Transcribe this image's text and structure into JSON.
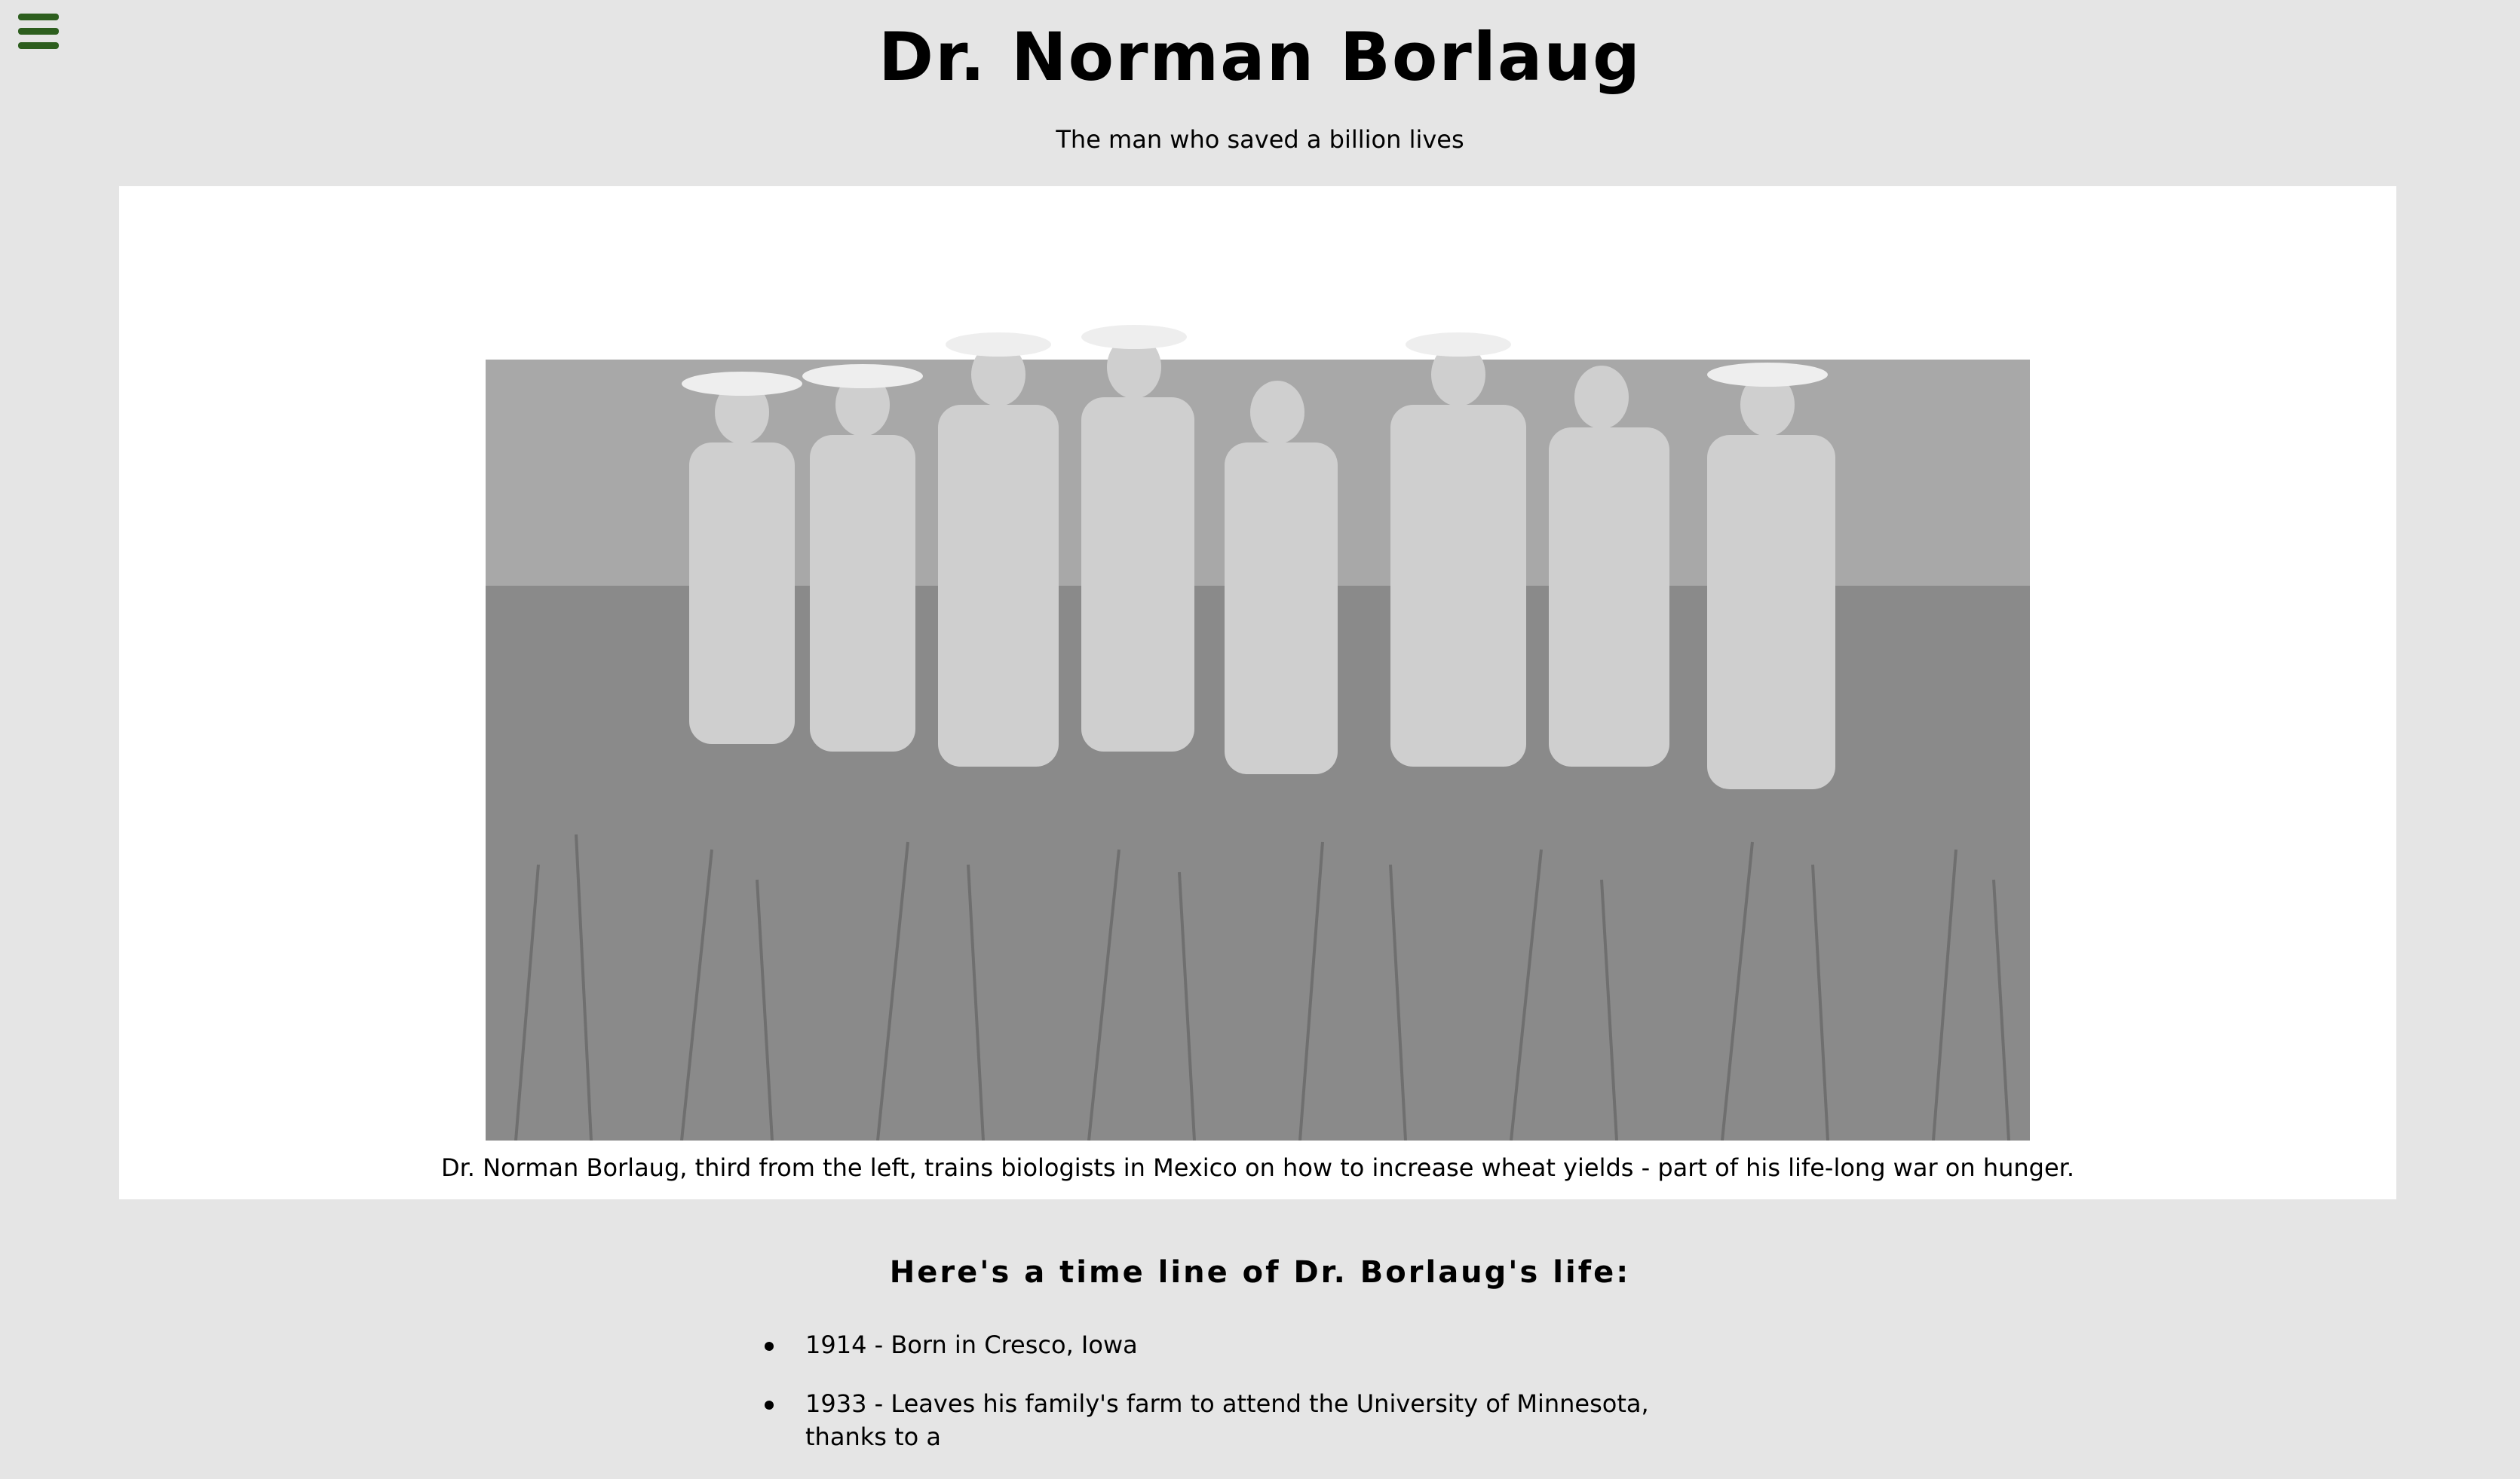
{
  "nav": {
    "menu_icon": "hamburger-menu-icon",
    "menu_color": "#2d5e1e"
  },
  "header": {
    "title": "Dr. Norman Borlaug",
    "subtitle": "The man who saved a billion lives"
  },
  "photo": {
    "caption": "Dr. Norman Borlaug, third from the left, trains biologists in Mexico on how to increase wheat yields - part of his life-long war on hunger."
  },
  "timeline": {
    "heading": "Here's a time line of Dr. Borlaug's life:",
    "items": [
      "1914 - Born in Cresco, Iowa",
      "1933 - Leaves his family's farm to attend the University of Minnesota, thanks to a"
    ]
  },
  "colors": {
    "background": "#e5e5e5",
    "panel": "#ffffff",
    "accent": "#2d5e1e"
  }
}
